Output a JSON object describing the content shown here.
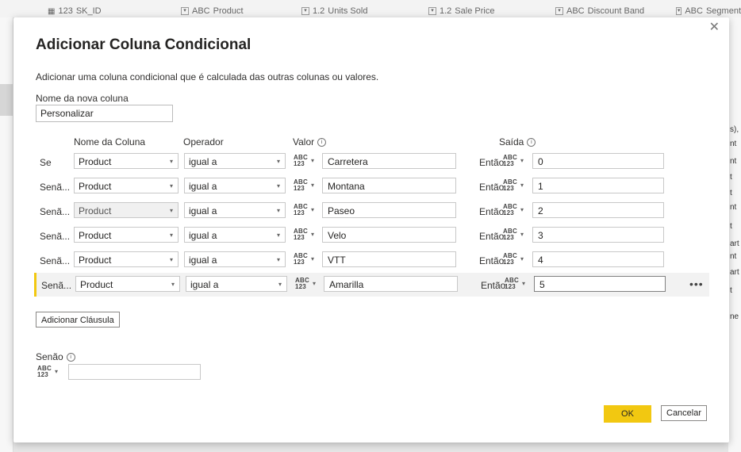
{
  "background": {
    "columns": [
      {
        "icon": "123",
        "label": "SK_ID"
      },
      {
        "icon": "ABC",
        "label": "Product"
      },
      {
        "icon": "1.2",
        "label": "Units Sold"
      },
      {
        "icon": "1.2",
        "label": "Sale Price"
      },
      {
        "icon": "ABC",
        "label": "Discount Band"
      },
      {
        "icon": "ABC",
        "label": "Segment"
      }
    ],
    "right_items": [
      "s),",
      "nt",
      "nt",
      "t",
      "t",
      "nt",
      "t",
      "art",
      "nt",
      "art",
      "t",
      "ne"
    ]
  },
  "dialog": {
    "title": "Adicionar Coluna Condicional",
    "description": "Adicionar uma coluna condicional que é calculada das outras colunas ou valores.",
    "close_glyph": "✕",
    "new_column_label": "Nome da nova coluna",
    "new_column_value": "Personalizar",
    "headers": {
      "column_name": "Nome da Coluna",
      "operator": "Operador",
      "value": "Valor",
      "output": "Saída"
    },
    "type_abc": "ABC",
    "type_123": "123",
    "then_label": "Então",
    "rows": [
      {
        "keyword": "Se",
        "column": "Product",
        "operator": "igual a",
        "value": "Carretera",
        "output": "0"
      },
      {
        "keyword": "Senã...",
        "column": "Product",
        "operator": "igual a",
        "value": "Montana",
        "output": "1"
      },
      {
        "keyword": "Senã...",
        "column": "Product",
        "operator": "igual a",
        "value": "Paseo",
        "output": "2"
      },
      {
        "keyword": "Senã...",
        "column": "Product",
        "operator": "igual a",
        "value": "Velo",
        "output": "3"
      },
      {
        "keyword": "Senã...",
        "column": "Product",
        "operator": "igual a",
        "value": "VTT",
        "output": "4"
      },
      {
        "keyword": "Senã...",
        "column": "Product",
        "operator": "igual a",
        "value": "Amarilla",
        "output": "5"
      }
    ],
    "more_glyph": "•••",
    "add_clause_label": "Adicionar Cláusula",
    "else_label": "Senão",
    "else_value": "",
    "ok_label": "OK",
    "cancel_label": "Cancelar"
  },
  "colors": {
    "accent": "#f2c811",
    "dialog_bg": "#ffffff",
    "backdrop": "#e6e6e6"
  }
}
